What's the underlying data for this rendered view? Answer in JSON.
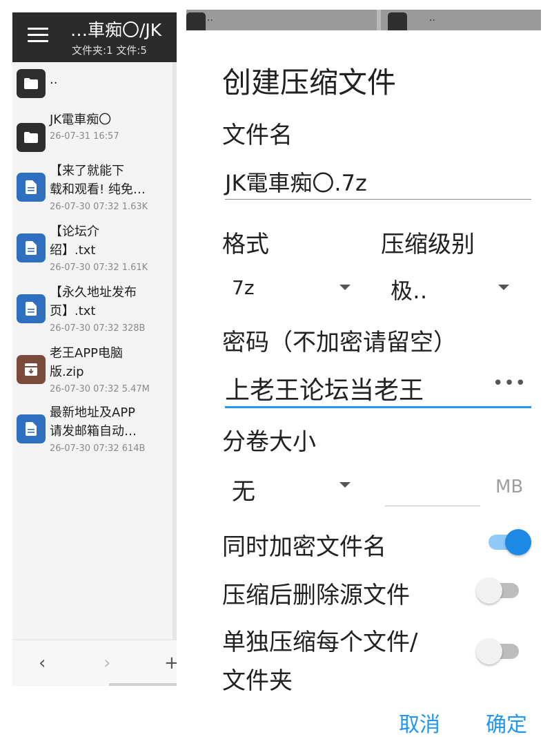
{
  "left_panel": {
    "path_title": "…車痴〇/JK",
    "counts": "文件夹:1  文件:5",
    "files": [
      {
        "name": "..",
        "meta": "",
        "icon": "folder-icon"
      },
      {
        "name": "JK電車痴〇",
        "meta": "26-07-31 16:57",
        "icon": "folder-icon"
      },
      {
        "name": "【来了就能下\n载和观看! 纯免…",
        "meta": "26-07-30 07:32  1.63K",
        "icon": "document-icon"
      },
      {
        "name": "【论坛介\n绍】.txt",
        "meta": "26-07-30 07:32  1.61K",
        "icon": "document-icon"
      },
      {
        "name": "【永久地址发布\n页】.txt",
        "meta": "26-07-30 07:32  328B",
        "icon": "document-icon"
      },
      {
        "name": "老王APP电脑\n版.zip",
        "meta": "26-07-30 07:32  5.47M",
        "icon": "archive-icon"
      },
      {
        "name": "最新地址及APP\n请发邮箱自动…",
        "meta": "26-07-30 07:32  614B",
        "icon": "document-icon"
      }
    ],
    "footer": {
      "back": "‹",
      "forward": "›",
      "add": "+"
    }
  },
  "background_strip": {
    "dots": ".."
  },
  "dialog": {
    "title": "创建压缩文件",
    "filename_label": "文件名",
    "filename_value": "JK電車痴〇.7z",
    "format_label": "格式",
    "format_value": "7z",
    "level_label": "压缩级别",
    "level_value": "极‥",
    "password_label": "密码（不加密请留空）",
    "password_value": "上老王论坛当老王",
    "password_toggle": "•••",
    "split_label": "分卷大小",
    "split_value": "无",
    "split_unit": "MB",
    "encrypt_names_label": "同时加密文件名",
    "encrypt_names_on": true,
    "delete_source_label": "压缩后删除源文件",
    "delete_source_on": false,
    "separate_label": "单独压缩每个文件/\n文件夹",
    "separate_on": false,
    "cancel_label": "取消",
    "confirm_label": "确定",
    "accent_color": "#2196f3"
  }
}
